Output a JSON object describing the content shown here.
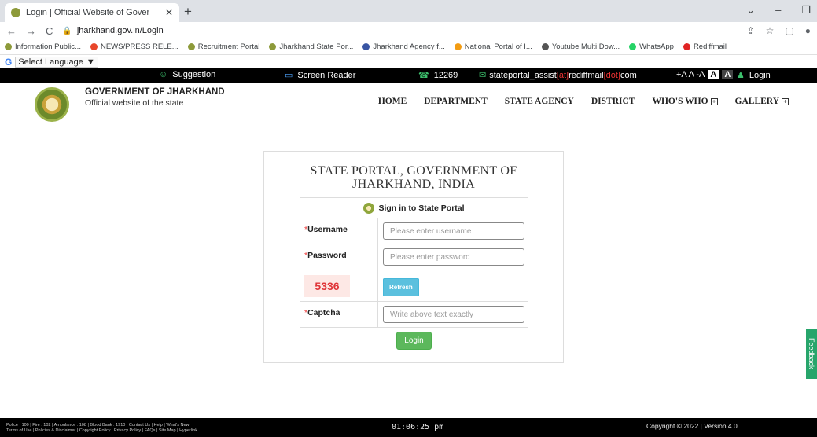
{
  "browser": {
    "tab_title": "Login | Official Website of Gover",
    "url": "jharkhand.gov.in/Login",
    "bookmarks": [
      {
        "label": "Information Public...",
        "color": "#8d9a3a"
      },
      {
        "label": "NEWS/PRESS RELE...",
        "color": "#e8462b"
      },
      {
        "label": "Recruitment Portal",
        "color": "#8d9a3a"
      },
      {
        "label": "Jharkhand State Por...",
        "color": "#8d9a3a"
      },
      {
        "label": "Jharkhand Agency f...",
        "color": "#3955a3"
      },
      {
        "label": "National Portal of I...",
        "color": "#f39c12"
      },
      {
        "label": "Youtube Multi Dow...",
        "color": "#555"
      },
      {
        "label": "WhatsApp",
        "color": "#25d366"
      },
      {
        "label": "Rediffmail",
        "color": "#e02424"
      }
    ]
  },
  "language": {
    "label": "Select Language",
    "arrow": "▼",
    "g": "G"
  },
  "topbar": {
    "suggestion": "Suggestion",
    "screen_reader": "Screen Reader",
    "phone": "12269",
    "email_user": "stateportal_assist",
    "email_at": "[at]",
    "email_domain": "rediffmail",
    "email_dot": "[dot]",
    "email_tld": "com",
    "font_sizes": "+A A -A",
    "a_light": "A",
    "a_dark": "A",
    "login": "Login"
  },
  "header": {
    "title": "GOVERNMENT OF JHARKHAND",
    "subtitle": "Official website of the state",
    "nav": [
      "HOME",
      "DEPARTMENT",
      "STATE AGENCY",
      "DISTRICT",
      "WHO'S WHO",
      "GALLERY"
    ]
  },
  "login": {
    "title_line1": "STATE PORTAL, GOVERNMENT OF",
    "title_line2": "JHARKHAND, INDIA",
    "signin": "Sign in to State Portal",
    "required_mark": "*",
    "username_label": "Username",
    "username_placeholder": "Please enter username",
    "password_label": "Password",
    "password_placeholder": "Please enter password",
    "captcha_code": "5336",
    "refresh": "Refresh",
    "captcha_label": "Captcha",
    "captcha_placeholder": "Write above text exactly",
    "login_button": "Login"
  },
  "feedback": "Feedback",
  "footer": {
    "links_line1": "Police : 100 | Fire : 102 | Ambulance : 108 | Blood Bank : 1910 | Contact Us | Help | What's New",
    "links_line2": "Terms of Use | Policies & Disclaimer | Copyright Policy | Privacy Policy | FAQs | Site Map | Hyperlink",
    "clock": "01:06:25 pm",
    "copyright": "Copyright © 2022 |  Version 4.0"
  }
}
